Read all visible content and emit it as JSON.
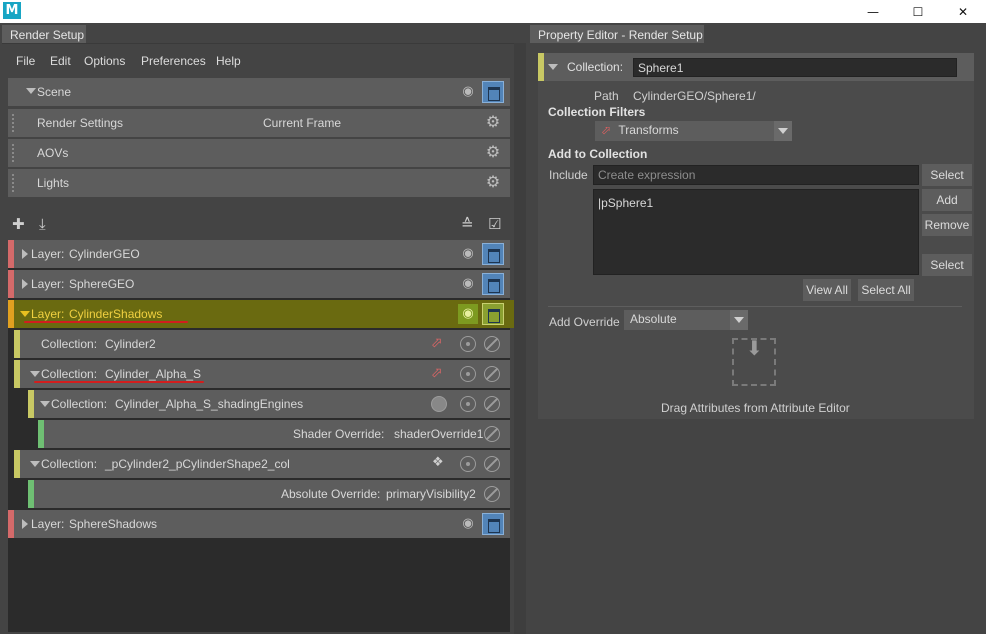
{
  "window": {
    "app_icon_letter": "M",
    "minimize": "—",
    "maximize": "☐",
    "close": "✕"
  },
  "left_tab": "Render Setup",
  "right_tab": "Property Editor - Render Setup",
  "menu": [
    "File",
    "Edit",
    "Options",
    "Preferences",
    "Help"
  ],
  "scene": {
    "title": "Scene",
    "items": [
      {
        "label": "Render Settings",
        "value": "Current Frame"
      },
      {
        "label": "AOVs",
        "value": ""
      },
      {
        "label": "Lights",
        "value": ""
      }
    ]
  },
  "layers": [
    {
      "prefix": "Layer:",
      "name": "CylinderGEO"
    },
    {
      "prefix": "Layer:",
      "name": "SphereGEO"
    },
    {
      "prefix": "Layer:",
      "name": "CylinderShadows"
    },
    {
      "prefix": "Layer:",
      "name": "SphereShadows"
    }
  ],
  "collections": [
    {
      "prefix": "Collection:",
      "name": "Cylinder2"
    },
    {
      "prefix": "Collection:",
      "name": "Cylinder_Alpha_S"
    },
    {
      "prefix": "Collection:",
      "name": "Cylinder_Alpha_S_shadingEngines"
    },
    {
      "prefix": "Collection:",
      "name": "_pCylinder2_pCylinderShape2_col"
    }
  ],
  "overrides": [
    {
      "label": "Shader Override:",
      "value": "shaderOverride1"
    },
    {
      "label": "Absolute Override:",
      "value": "primaryVisibility2"
    }
  ],
  "property_editor": {
    "collection_label": "Collection:",
    "collection_name": "Sphere1",
    "path_label": "Path",
    "path_value": "CylinderGEO/Sphere1/",
    "filters_label": "Collection Filters",
    "filter_value": "Transforms",
    "add_to_collection_label": "Add to Collection",
    "include_label": "Include",
    "include_placeholder": "Create expression",
    "select_button": "Select",
    "add_button": "Add",
    "remove_button": "Remove",
    "select_button2": "Select",
    "list_items": [
      "|pSphere1"
    ],
    "view_all_button": "View All",
    "select_all_button": "Select All",
    "add_override_label": "Add Override",
    "override_mode": "Absolute",
    "drag_text": "Drag Attributes from Attribute Editor"
  },
  "colors": {
    "layer_bar": "#d46a6a",
    "collection_bar": "#c8c864",
    "override_bar": "#6fbf73",
    "active_layer_bg": "#6a6a10",
    "render_button": "#5284b8"
  }
}
